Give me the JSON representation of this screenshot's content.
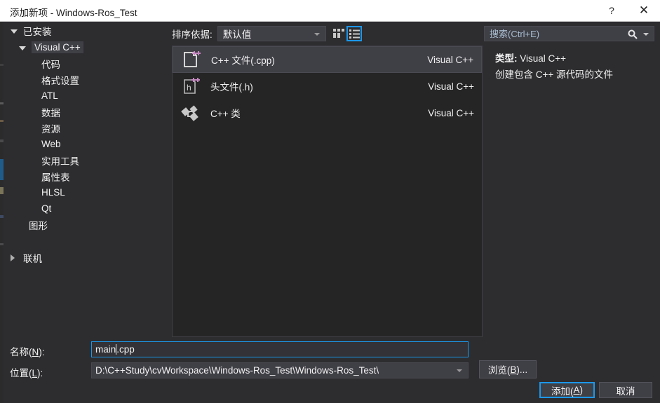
{
  "window": {
    "title": "添加新项 - Windows-Ros_Test",
    "help_label": "?",
    "close_label": "✕"
  },
  "sidebar": {
    "root_label": "已安装",
    "items": [
      {
        "label": "Visual C++",
        "level": 0,
        "selected": true,
        "expanded": true
      },
      {
        "label": "代码",
        "level": 1,
        "selected": false
      },
      {
        "label": "格式设置",
        "level": 1,
        "selected": false
      },
      {
        "label": "ATL",
        "level": 1,
        "selected": false
      },
      {
        "label": "数据",
        "level": 1,
        "selected": false
      },
      {
        "label": "资源",
        "level": 1,
        "selected": false
      },
      {
        "label": "Web",
        "level": 1,
        "selected": false
      },
      {
        "label": "实用工具",
        "level": 1,
        "selected": false
      },
      {
        "label": "属性表",
        "level": 1,
        "selected": false
      },
      {
        "label": "HLSL",
        "level": 1,
        "selected": false
      },
      {
        "label": "Qt",
        "level": 1,
        "selected": false
      },
      {
        "label": "图形",
        "level": 0,
        "selected": false,
        "expanded": null
      }
    ],
    "online_label": "联机"
  },
  "toolbar": {
    "sort_label": "排序依据:",
    "sort_value": "默认值",
    "tiles_view_name": "tiles-view-icon",
    "list_view_name": "list-view-icon"
  },
  "search": {
    "placeholder": "搜索(Ctrl+E)",
    "value": ""
  },
  "item_list": {
    "items": [
      {
        "name": "C++ 文件(.cpp)",
        "origin": "Visual C++",
        "icon": "cpp-file-icon",
        "selected": true
      },
      {
        "name": "头文件(.h)",
        "origin": "Visual C++",
        "icon": "header-file-icon",
        "selected": false
      },
      {
        "name": "C++ 类",
        "origin": "Visual C++",
        "icon": "cpp-class-icon",
        "selected": false
      }
    ]
  },
  "info": {
    "type_label": "类型:",
    "type_value": "Visual C++",
    "description": "创建包含 C++ 源代码的文件"
  },
  "form": {
    "name_label_pre": "名称(",
    "name_label_key": "N",
    "name_label_post": "):",
    "name_value_head": "main",
    "name_value_tail": ".cpp",
    "location_label_pre": "位置(",
    "location_label_key": "L",
    "location_label_post": "):",
    "location_value": "D:\\C++Study\\cvWorkspace\\Windows-Ros_Test\\Windows-Ros_Test\\"
  },
  "buttons": {
    "browse_pre": "浏览(",
    "browse_key": "B",
    "browse_post": ")...",
    "add_pre": "添加(",
    "add_key": "A",
    "add_post": ")",
    "cancel": "取消"
  },
  "colors": {
    "dialog_bg": "#2d2d30",
    "panel_bg": "#252526",
    "accent": "#1c97ea",
    "selection": "#3f3f46",
    "titlebar_bg": "#ffffff",
    "icon_plus": "#c586c0"
  }
}
